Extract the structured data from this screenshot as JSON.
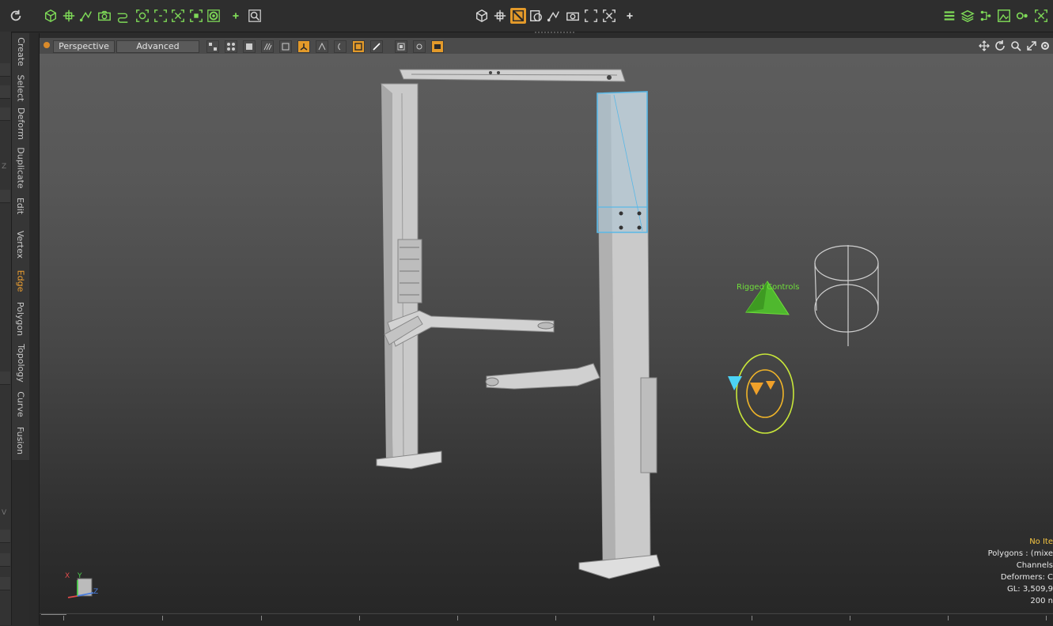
{
  "topbar": {
    "left_tools": [
      "refresh-icon",
      "cube-icon",
      "move-icon",
      "bone-icon",
      "camera-icon",
      "link-icon",
      "target-icon",
      "focus-icon",
      "snap-icon",
      "frame-icon",
      "gear-icon",
      "plus-icon",
      "search-icon"
    ],
    "center_tools": [
      "cube-icon",
      "move-icon",
      "edge-select-icon",
      "loop-icon",
      "bone-icon",
      "camera-icon",
      "snap-icon",
      "plus-icon"
    ],
    "right_tools": [
      "list-icon",
      "layers-icon",
      "grid-icon",
      "image-icon",
      "settings-icon",
      "snap-icon"
    ]
  },
  "side_tabs": [
    {
      "label": "Create",
      "selected": false
    },
    {
      "label": "Select",
      "selected": false
    },
    {
      "label": "Deform",
      "selected": false
    },
    {
      "label": "Duplicate",
      "selected": false
    },
    {
      "label": "Edit",
      "selected": false
    },
    {
      "label": "Vertex",
      "selected": false
    },
    {
      "label": "Edge",
      "selected": true
    },
    {
      "label": "Polygon",
      "selected": false
    },
    {
      "label": "Topology",
      "selected": false
    },
    {
      "label": "Curve",
      "selected": false
    },
    {
      "label": "Fusion",
      "selected": false
    }
  ],
  "left_strip": {
    "marks": [
      "Z",
      "V"
    ]
  },
  "viewport": {
    "view_mode": "Perspective",
    "shading_mode": "Advanced",
    "rig_label": "Rigged Controls",
    "stats": {
      "selection": "No Ite",
      "polygons": "Polygons : (mixe",
      "channels": "Channels",
      "deformers": "Deformers: C",
      "gl": "GL: 3,509,9",
      "time": "200 n"
    },
    "axis": {
      "x": "X",
      "y": "Y",
      "z": "Z"
    }
  },
  "colors": {
    "accent": "#e39a2a",
    "rig_green": "#6fdf3a",
    "selection_blue": "#5ab8e6",
    "stats_highlight": "#f5c542"
  }
}
